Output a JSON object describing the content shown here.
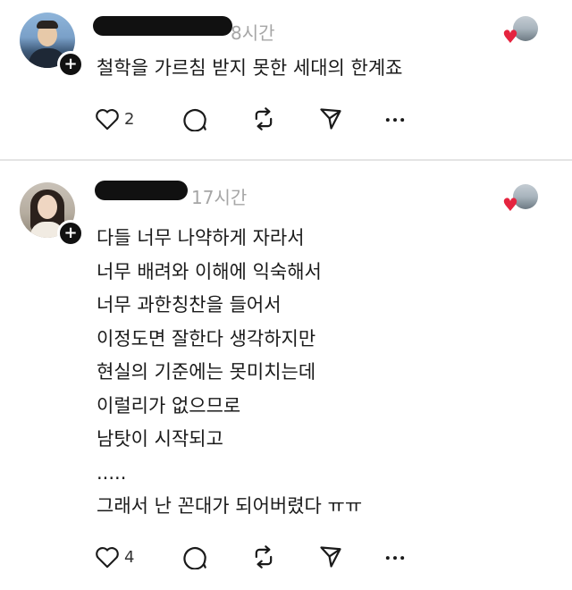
{
  "posts": [
    {
      "username": "",
      "time": "8시간",
      "text": "철학을 가르침 받지 못한 세대의 한계죠",
      "actions": {
        "like_count": "2"
      }
    },
    {
      "username": "",
      "time": "17시간",
      "lines": [
        "다들 너무 나약하게 자라서",
        "너무 배려와 이해에 익숙해서",
        "너무 과한칭찬을 들어서",
        "이정도면 잘한다 생각하지만",
        "현실의 기준에는 못미치는데",
        "이럴리가 없으므로",
        "남탓이 시작되고",
        ".....",
        "그래서 난 꼰대가 되어버렸다 ㅠㅠ"
      ],
      "actions": {
        "like_count": "4"
      }
    }
  ],
  "icons": {
    "like": "heart-outline-icon",
    "reply": "comment-bubble-icon",
    "repost": "repost-icon",
    "share": "send-icon",
    "more": "more-icon"
  },
  "colors": {
    "heart_badge": "#e5243f",
    "muted_text": "#a6a6a6"
  }
}
